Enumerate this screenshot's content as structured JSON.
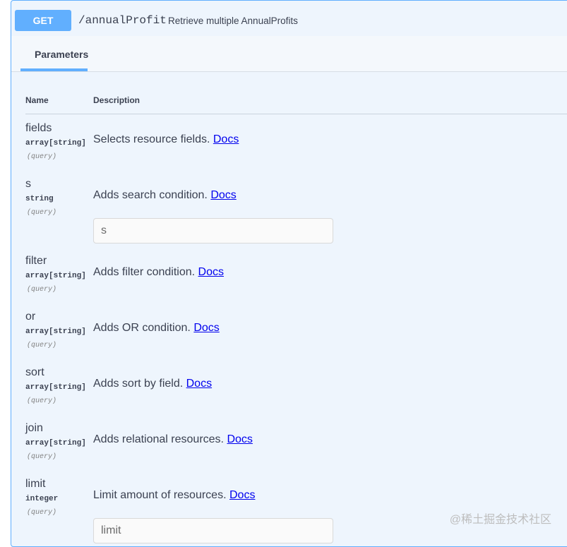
{
  "operation": {
    "method": "GET",
    "path": "/annualProfit",
    "summary": "Retrieve multiple AnnualProfits",
    "method_color": "#61affe"
  },
  "tabs": [
    {
      "label": "Parameters"
    }
  ],
  "table": {
    "headers": {
      "name": "Name",
      "description": "Description"
    }
  },
  "params": [
    {
      "name": "fields",
      "type": "array[string]",
      "in": "(query)",
      "desc": "Selects resource fields.",
      "link": "Docs"
    },
    {
      "name": "s",
      "type": "string",
      "in": "(query)",
      "desc": "Adds search condition.",
      "link": "Docs",
      "placeholder": "s"
    },
    {
      "name": "filter",
      "type": "array[string]",
      "in": "(query)",
      "desc": "Adds filter condition.",
      "link": "Docs"
    },
    {
      "name": "or",
      "type": "array[string]",
      "in": "(query)",
      "desc": "Adds OR condition.",
      "link": "Docs"
    },
    {
      "name": "sort",
      "type": "array[string]",
      "in": "(query)",
      "desc": "Adds sort by field.",
      "link": "Docs"
    },
    {
      "name": "join",
      "type": "array[string]",
      "in": "(query)",
      "desc": "Adds relational resources.",
      "link": "Docs"
    },
    {
      "name": "limit",
      "type": "integer",
      "in": "(query)",
      "desc": "Limit amount of resources.",
      "link": "Docs",
      "placeholder": "limit"
    }
  ],
  "watermark": "@稀土掘金技术社区"
}
